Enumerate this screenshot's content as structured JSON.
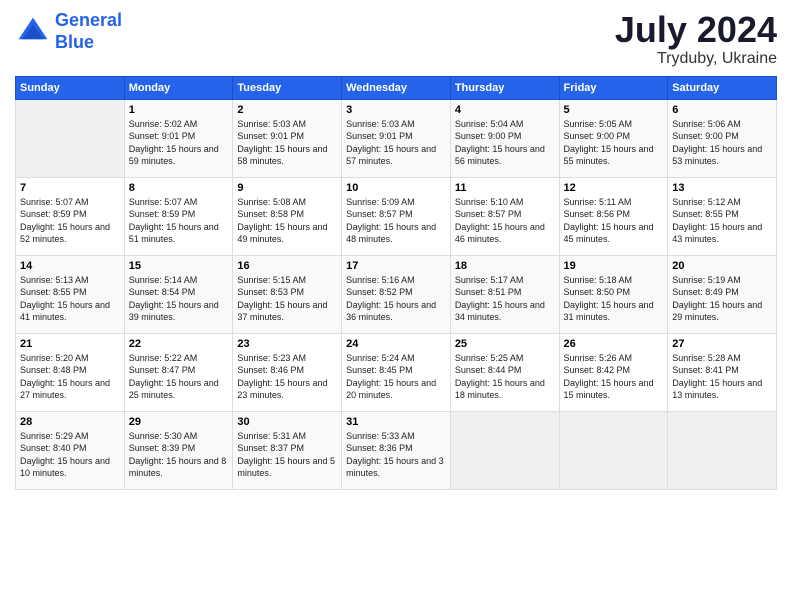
{
  "logo": {
    "line1": "General",
    "line2": "Blue"
  },
  "title": "July 2024",
  "location": "Tryduby, Ukraine",
  "days_header": [
    "Sunday",
    "Monday",
    "Tuesday",
    "Wednesday",
    "Thursday",
    "Friday",
    "Saturday"
  ],
  "weeks": [
    [
      {
        "num": "",
        "sunrise": "",
        "sunset": "",
        "daylight": ""
      },
      {
        "num": "1",
        "sunrise": "Sunrise: 5:02 AM",
        "sunset": "Sunset: 9:01 PM",
        "daylight": "Daylight: 15 hours and 59 minutes."
      },
      {
        "num": "2",
        "sunrise": "Sunrise: 5:03 AM",
        "sunset": "Sunset: 9:01 PM",
        "daylight": "Daylight: 15 hours and 58 minutes."
      },
      {
        "num": "3",
        "sunrise": "Sunrise: 5:03 AM",
        "sunset": "Sunset: 9:01 PM",
        "daylight": "Daylight: 15 hours and 57 minutes."
      },
      {
        "num": "4",
        "sunrise": "Sunrise: 5:04 AM",
        "sunset": "Sunset: 9:00 PM",
        "daylight": "Daylight: 15 hours and 56 minutes."
      },
      {
        "num": "5",
        "sunrise": "Sunrise: 5:05 AM",
        "sunset": "Sunset: 9:00 PM",
        "daylight": "Daylight: 15 hours and 55 minutes."
      },
      {
        "num": "6",
        "sunrise": "Sunrise: 5:06 AM",
        "sunset": "Sunset: 9:00 PM",
        "daylight": "Daylight: 15 hours and 53 minutes."
      }
    ],
    [
      {
        "num": "7",
        "sunrise": "Sunrise: 5:07 AM",
        "sunset": "Sunset: 8:59 PM",
        "daylight": "Daylight: 15 hours and 52 minutes."
      },
      {
        "num": "8",
        "sunrise": "Sunrise: 5:07 AM",
        "sunset": "Sunset: 8:59 PM",
        "daylight": "Daylight: 15 hours and 51 minutes."
      },
      {
        "num": "9",
        "sunrise": "Sunrise: 5:08 AM",
        "sunset": "Sunset: 8:58 PM",
        "daylight": "Daylight: 15 hours and 49 minutes."
      },
      {
        "num": "10",
        "sunrise": "Sunrise: 5:09 AM",
        "sunset": "Sunset: 8:57 PM",
        "daylight": "Daylight: 15 hours and 48 minutes."
      },
      {
        "num": "11",
        "sunrise": "Sunrise: 5:10 AM",
        "sunset": "Sunset: 8:57 PM",
        "daylight": "Daylight: 15 hours and 46 minutes."
      },
      {
        "num": "12",
        "sunrise": "Sunrise: 5:11 AM",
        "sunset": "Sunset: 8:56 PM",
        "daylight": "Daylight: 15 hours and 45 minutes."
      },
      {
        "num": "13",
        "sunrise": "Sunrise: 5:12 AM",
        "sunset": "Sunset: 8:55 PM",
        "daylight": "Daylight: 15 hours and 43 minutes."
      }
    ],
    [
      {
        "num": "14",
        "sunrise": "Sunrise: 5:13 AM",
        "sunset": "Sunset: 8:55 PM",
        "daylight": "Daylight: 15 hours and 41 minutes."
      },
      {
        "num": "15",
        "sunrise": "Sunrise: 5:14 AM",
        "sunset": "Sunset: 8:54 PM",
        "daylight": "Daylight: 15 hours and 39 minutes."
      },
      {
        "num": "16",
        "sunrise": "Sunrise: 5:15 AM",
        "sunset": "Sunset: 8:53 PM",
        "daylight": "Daylight: 15 hours and 37 minutes."
      },
      {
        "num": "17",
        "sunrise": "Sunrise: 5:16 AM",
        "sunset": "Sunset: 8:52 PM",
        "daylight": "Daylight: 15 hours and 36 minutes."
      },
      {
        "num": "18",
        "sunrise": "Sunrise: 5:17 AM",
        "sunset": "Sunset: 8:51 PM",
        "daylight": "Daylight: 15 hours and 34 minutes."
      },
      {
        "num": "19",
        "sunrise": "Sunrise: 5:18 AM",
        "sunset": "Sunset: 8:50 PM",
        "daylight": "Daylight: 15 hours and 31 minutes."
      },
      {
        "num": "20",
        "sunrise": "Sunrise: 5:19 AM",
        "sunset": "Sunset: 8:49 PM",
        "daylight": "Daylight: 15 hours and 29 minutes."
      }
    ],
    [
      {
        "num": "21",
        "sunrise": "Sunrise: 5:20 AM",
        "sunset": "Sunset: 8:48 PM",
        "daylight": "Daylight: 15 hours and 27 minutes."
      },
      {
        "num": "22",
        "sunrise": "Sunrise: 5:22 AM",
        "sunset": "Sunset: 8:47 PM",
        "daylight": "Daylight: 15 hours and 25 minutes."
      },
      {
        "num": "23",
        "sunrise": "Sunrise: 5:23 AM",
        "sunset": "Sunset: 8:46 PM",
        "daylight": "Daylight: 15 hours and 23 minutes."
      },
      {
        "num": "24",
        "sunrise": "Sunrise: 5:24 AM",
        "sunset": "Sunset: 8:45 PM",
        "daylight": "Daylight: 15 hours and 20 minutes."
      },
      {
        "num": "25",
        "sunrise": "Sunrise: 5:25 AM",
        "sunset": "Sunset: 8:44 PM",
        "daylight": "Daylight: 15 hours and 18 minutes."
      },
      {
        "num": "26",
        "sunrise": "Sunrise: 5:26 AM",
        "sunset": "Sunset: 8:42 PM",
        "daylight": "Daylight: 15 hours and 15 minutes."
      },
      {
        "num": "27",
        "sunrise": "Sunrise: 5:28 AM",
        "sunset": "Sunset: 8:41 PM",
        "daylight": "Daylight: 15 hours and 13 minutes."
      }
    ],
    [
      {
        "num": "28",
        "sunrise": "Sunrise: 5:29 AM",
        "sunset": "Sunset: 8:40 PM",
        "daylight": "Daylight: 15 hours and 10 minutes."
      },
      {
        "num": "29",
        "sunrise": "Sunrise: 5:30 AM",
        "sunset": "Sunset: 8:39 PM",
        "daylight": "Daylight: 15 hours and 8 minutes."
      },
      {
        "num": "30",
        "sunrise": "Sunrise: 5:31 AM",
        "sunset": "Sunset: 8:37 PM",
        "daylight": "Daylight: 15 hours and 5 minutes."
      },
      {
        "num": "31",
        "sunrise": "Sunrise: 5:33 AM",
        "sunset": "Sunset: 8:36 PM",
        "daylight": "Daylight: 15 hours and 3 minutes."
      },
      {
        "num": "",
        "sunrise": "",
        "sunset": "",
        "daylight": ""
      },
      {
        "num": "",
        "sunrise": "",
        "sunset": "",
        "daylight": ""
      },
      {
        "num": "",
        "sunrise": "",
        "sunset": "",
        "daylight": ""
      }
    ]
  ]
}
